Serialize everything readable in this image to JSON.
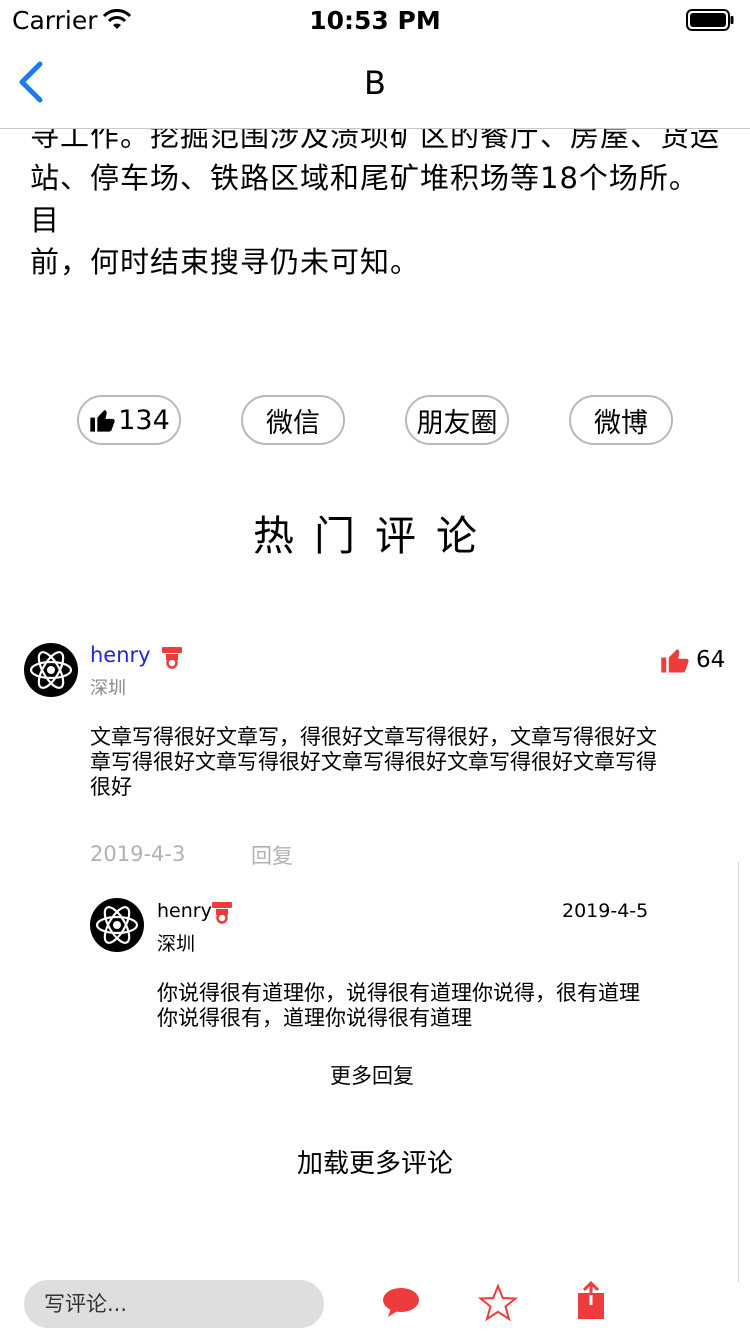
{
  "status_bar": {
    "carrier": "Carrier",
    "time": "10:53 PM"
  },
  "nav": {
    "title": "B"
  },
  "article": {
    "lines": [
      "寻工作。挖掘范围涉及溃坝矿区的餐厅、房屋、货运",
      "站、停车场、铁路区域和尾矿堆积场等18个场所。目",
      "前，何时结束搜寻仍未可知。"
    ]
  },
  "share": {
    "like_count": "134",
    "wechat": "微信",
    "moments": "朋友圈",
    "weibo": "微博"
  },
  "hot_comments_title": "热门评论",
  "comment": {
    "username": "henry",
    "city": "深圳",
    "likes": "64",
    "text": "文章写得很好文章写，得很好文章写得很好，文章写得很好文章写得很好文章写得很好文章写得很好文章写得很好文章写得很好",
    "date": "2019-4-3",
    "reply_label": "回复",
    "reply": {
      "username": "henry",
      "city": "深圳",
      "date": "2019-4-5",
      "text": "你说得很有道理你，说得很有道理你说得，很有道理你说得很有，道理你说得很有道理"
    },
    "more_replies": "更多回复"
  },
  "load_more": "加载更多评论",
  "bottom_bar": {
    "placeholder": "写评论..."
  },
  "colors": {
    "accent_red": "#ee3b3b",
    "link_blue": "#1b27d8",
    "ios_blue": "#1a7cf5"
  }
}
